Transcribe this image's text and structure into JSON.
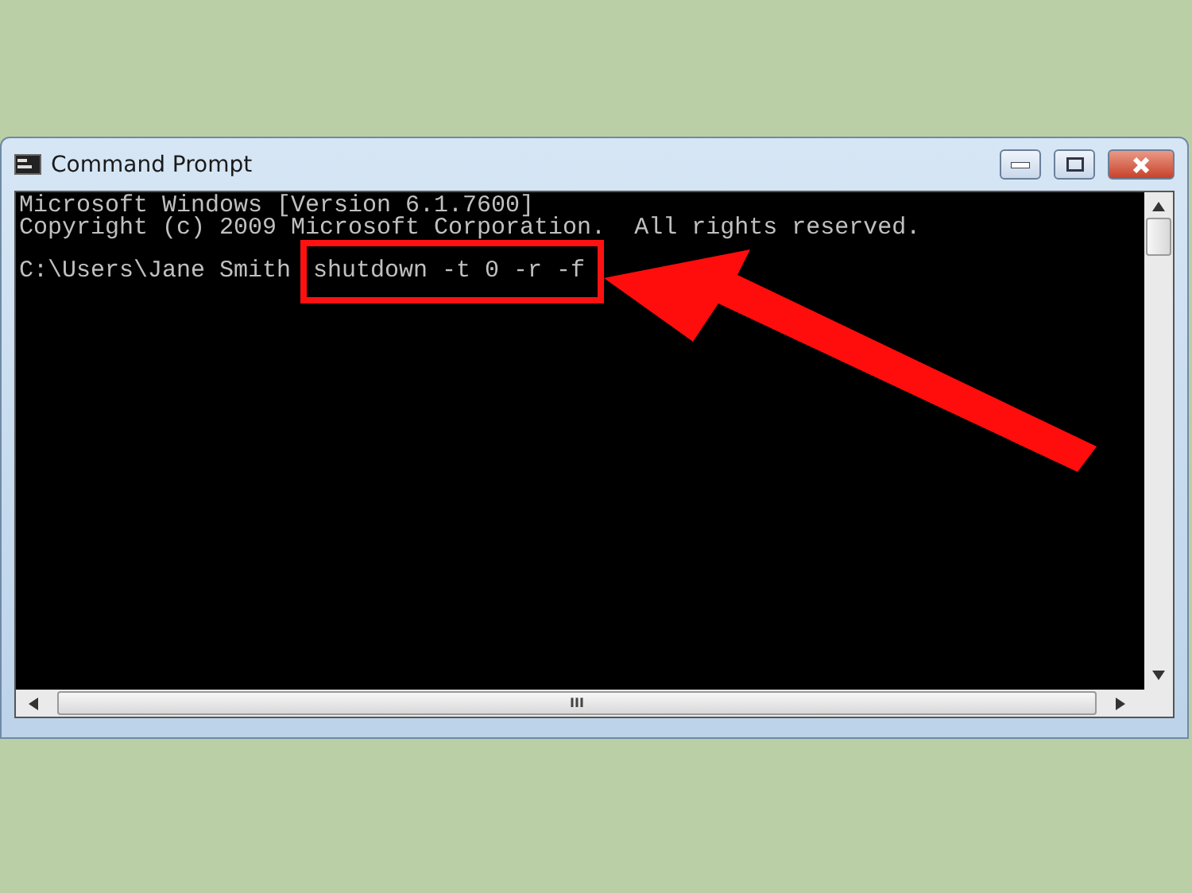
{
  "window": {
    "title": "Command Prompt"
  },
  "console": {
    "lines": [
      "Microsoft Windows [Version 6.1.7600]",
      "Copyright (c) 2009 Microsoft Corporation.  All rights reserved."
    ],
    "prompt": "C:\\Users\\Jane Smith",
    "command": "shutdown -t 0 -r -f",
    "highlighted": true
  },
  "scrollbar_grip": "III"
}
